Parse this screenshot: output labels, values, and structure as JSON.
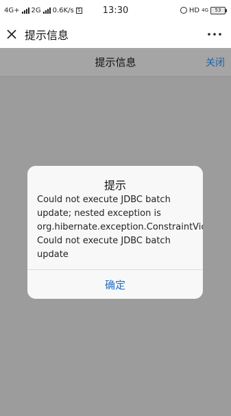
{
  "status_bar": {
    "network1": "4G+",
    "network2": "2G",
    "speed": "0.6K/s",
    "time": "13:30",
    "hd": "HD",
    "net_small": "4G",
    "battery": "53"
  },
  "app_bar": {
    "title": "提示信息",
    "close_icon": "close-icon",
    "more_icon": "more-icon"
  },
  "page": {
    "title": "提示信息",
    "close_label": "关闭"
  },
  "dialog": {
    "title": "提示",
    "message_lines": [
      "Could not execute JDBC batch",
      "update; nested exception is",
      "org.hibernate.exception.ConstraintViola",
      "Could not execute JDBC batch",
      "update"
    ],
    "ok_label": "确定"
  },
  "colors": {
    "overlay": "#9c9c9c",
    "link": "#1e64a8",
    "button": "#1e6ec4"
  }
}
